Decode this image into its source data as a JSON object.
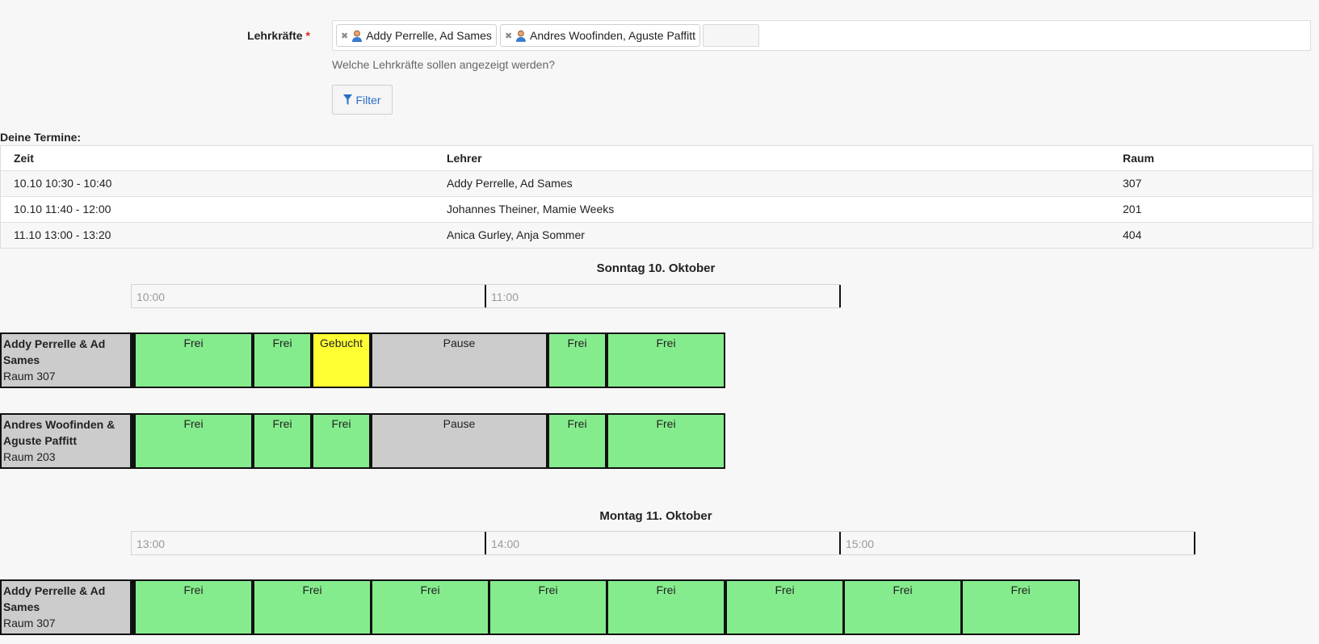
{
  "filter": {
    "label": "Lehrkräfte",
    "required_mark": "*",
    "tags": [
      {
        "name": "Addy Perrelle, Ad Sames"
      },
      {
        "name": "Andres Woofinden, Aguste Paffitt"
      }
    ],
    "help_text": "Welche Lehrkräfte sollen angezeigt werden?",
    "button_label": "Filter"
  },
  "appointments": {
    "title": "Deine Termine:",
    "columns": [
      "Zeit",
      "Lehrer",
      "Raum"
    ],
    "rows": [
      [
        "10.10 10:30 - 10:40",
        "Addy Perrelle, Ad Sames",
        "307"
      ],
      [
        "10.10 11:40 - 12:00",
        "Johannes Theiner, Mamie Weeks",
        "201"
      ],
      [
        "11.10 13:00 - 13:20",
        "Anica Gurley, Anja Sommer",
        "404"
      ]
    ]
  },
  "days": [
    {
      "title": "Sonntag 10. Oktober",
      "hours": [
        "10:00",
        "11:00"
      ],
      "rooms": [
        {
          "teachers": "Addy Perrelle & Ad Sames",
          "room": "Raum 307",
          "slots": [
            {
              "label": "Frei",
              "status": "frei"
            },
            {
              "label": "Frei",
              "status": "frei"
            },
            {
              "label": "Gebucht",
              "status": "gebucht"
            },
            {
              "label": "Pause",
              "status": "pause"
            },
            {
              "label": "Frei",
              "status": "frei"
            },
            {
              "label": "Frei",
              "status": "frei"
            }
          ]
        },
        {
          "teachers": "Andres Woofinden & Aguste Paffitt",
          "room": "Raum 203",
          "slots": [
            {
              "label": "Frei",
              "status": "frei"
            },
            {
              "label": "Frei",
              "status": "frei"
            },
            {
              "label": "Frei",
              "status": "frei"
            },
            {
              "label": "Pause",
              "status": "pause"
            },
            {
              "label": "Frei",
              "status": "frei"
            },
            {
              "label": "Frei",
              "status": "frei"
            }
          ]
        }
      ]
    },
    {
      "title": "Montag 11. Oktober",
      "hours": [
        "13:00",
        "14:00",
        "15:00"
      ],
      "rooms": [
        {
          "teachers": "Addy Perrelle & Ad Sames",
          "room": "Raum 307",
          "slots": [
            {
              "label": "Frei",
              "status": "frei"
            },
            {
              "label": "Frei",
              "status": "frei"
            },
            {
              "label": "Frei",
              "status": "frei"
            },
            {
              "label": "Frei",
              "status": "frei"
            },
            {
              "label": "Frei",
              "status": "frei"
            },
            {
              "label": "Frei",
              "status": "frei"
            },
            {
              "label": "Frei",
              "status": "frei"
            },
            {
              "label": "Frei",
              "status": "frei"
            }
          ]
        }
      ]
    }
  ],
  "colors": {
    "frei": "#85ec8d",
    "gebucht": "#ffff33",
    "pause": "#cccccc",
    "link": "#2a6fc7",
    "required": "#e02020"
  }
}
